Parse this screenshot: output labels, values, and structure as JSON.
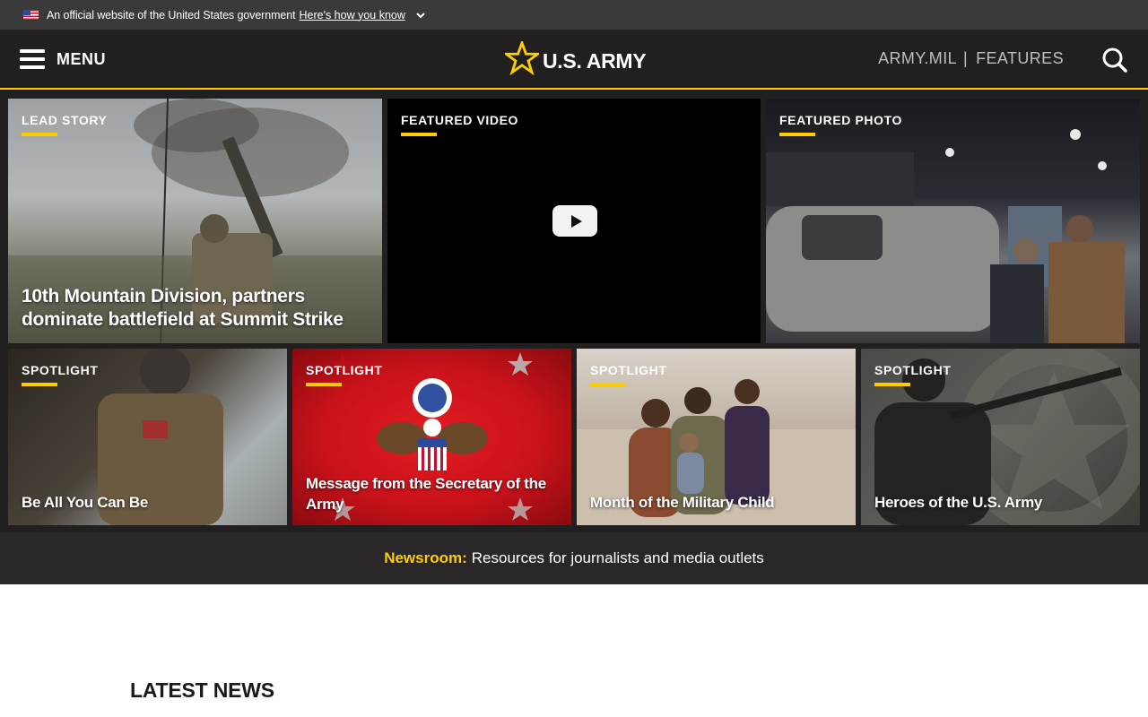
{
  "gov_banner": {
    "text": "An official website of the United States government",
    "link": "Here's how you know"
  },
  "header": {
    "menu_label": "MENU",
    "logo_text": "U.S. ARMY",
    "nav": [
      "ARMY.MIL",
      "|",
      "FEATURES"
    ]
  },
  "tiles": {
    "lead": {
      "label": "LEAD STORY",
      "headline": "10th Mountain Division, partners dominate battlefield at Summit Strike"
    },
    "video": {
      "label": "FEATURED VIDEO"
    },
    "photo": {
      "label": "FEATURED PHOTO"
    },
    "spotlights": [
      {
        "label": "SPOTLIGHT",
        "headline": "Be All You Can Be"
      },
      {
        "label": "SPOTLIGHT",
        "headline": "Message from the Secretary of the Army"
      },
      {
        "label": "SPOTLIGHT",
        "headline": "Month of the Military Child"
      },
      {
        "label": "SPOTLIGHT",
        "headline": "Heroes of the U.S. Army"
      }
    ]
  },
  "newsroom": {
    "label": "Newsroom:",
    "text": "Resources for journalists and media outlets"
  },
  "latest_news": {
    "title": "LATEST NEWS"
  },
  "colors": {
    "accent": "#ffcc01",
    "header_bg": "#221f20",
    "banner_bg": "#3a3a3a"
  }
}
